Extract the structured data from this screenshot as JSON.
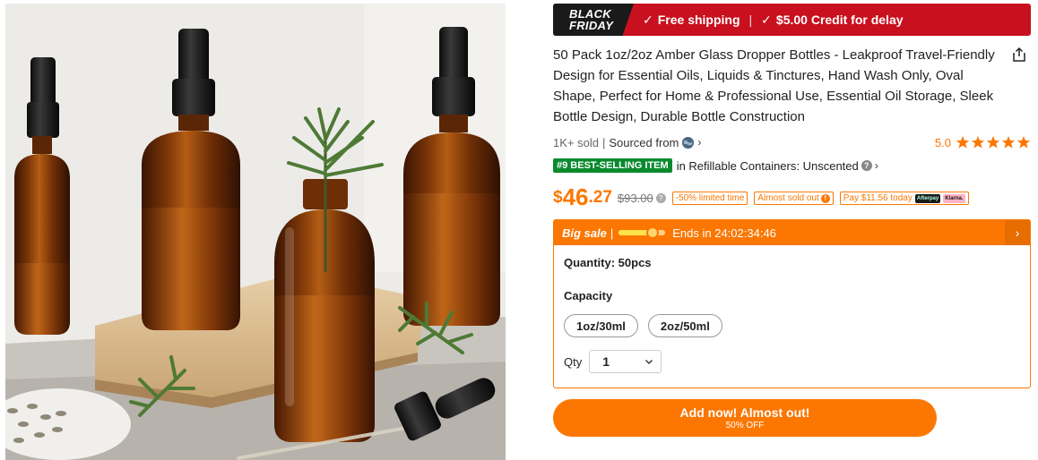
{
  "banner": {
    "badge_line1": "BLACK",
    "badge_line2": "FRIDAY",
    "free_shipping": "Free shipping",
    "credit": "$5.00 Credit for delay"
  },
  "product": {
    "title": "50 Pack 1oz/2oz Amber Glass Dropper Bottles - Leakproof Travel-Friendly Design for Essential Oils, Liquids & Tinctures, Hand Wash Only, Oval Shape, Perfect for Home & Professional Use, Essential Oil Storage, Sleek Bottle Design, Durable Bottle Construction",
    "sold": "1K+ sold",
    "sourced_from": "Sourced from",
    "rating": "5.0",
    "star_count": 5,
    "bestseller_badge": "#9 BEST-SELLING ITEM",
    "category": "in Refillable Containers: Unscented"
  },
  "price": {
    "currency": "$",
    "integer": "46",
    "decimal": ".27",
    "original": "$93.00",
    "tag_discount": "-50% limited time",
    "tag_stock": "Almost sold out",
    "tag_pay": "Pay $11.56 today",
    "pay_logo1": "Afterpay",
    "pay_logo2": "Klarna."
  },
  "sale": {
    "label": "Big sale",
    "pipe": "|",
    "progress": 0.72,
    "ends": "Ends in 24:02:34:46",
    "quantity": "Quantity: 50pcs",
    "capacity_label": "Capacity",
    "options": [
      "1oz/30ml",
      "2oz/50ml"
    ],
    "qty_label": "Qty",
    "qty_value": "1"
  },
  "cta": {
    "main": "Add now! Almost out!",
    "sub": "50% OFF"
  },
  "colors": {
    "accent": "#fb7701",
    "banner_red": "#c8101f",
    "bestseller_green": "#0a8a2e"
  },
  "icons": {
    "share": "share-icon",
    "globe": "globe-icon",
    "star": "star-icon",
    "check": "check-icon",
    "chevron": "chevron-right-icon",
    "dropdown": "chevron-down-icon"
  }
}
